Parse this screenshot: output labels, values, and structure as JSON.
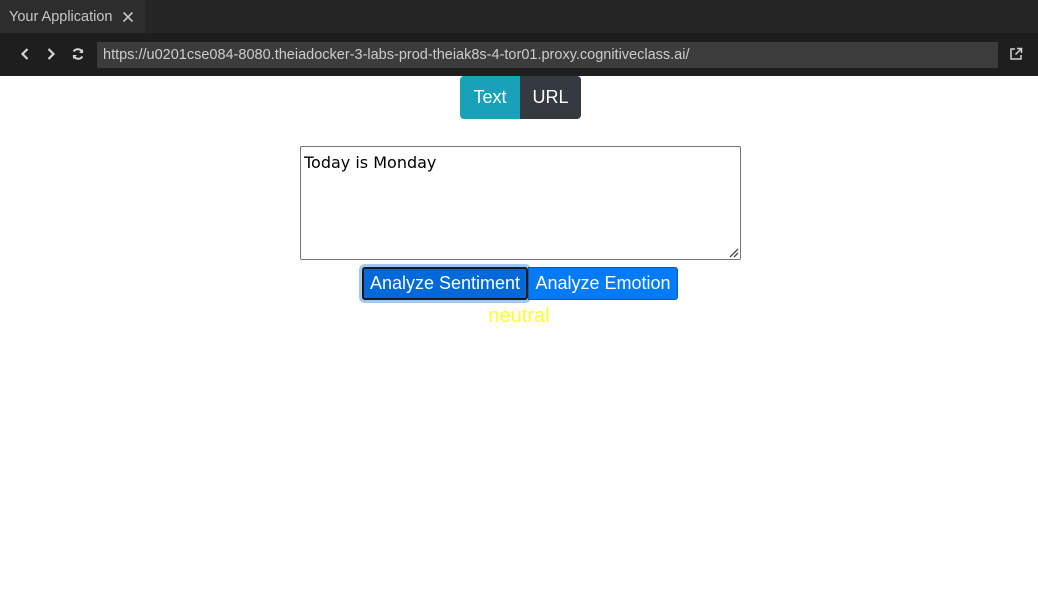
{
  "tab": {
    "title": "Your Application",
    "close_icon": "close-icon"
  },
  "toolbar": {
    "back_icon": "chevron-left-icon",
    "forward_icon": "chevron-right-icon",
    "reload_icon": "refresh-icon",
    "url": "https://u0201cse084-8080.theiadocker-3-labs-prod-theiak8s-4-tor01.proxy.cognitiveclass.ai/",
    "open_external_icon": "external-link-icon"
  },
  "modes": {
    "text_label": "Text",
    "url_label": "URL",
    "text_color": "#17a2b8",
    "url_color": "#343a40"
  },
  "input": {
    "value": "Today is Monday"
  },
  "actions": {
    "sentiment_label": "Analyze Sentiment",
    "emotion_label": "Analyze Emotion"
  },
  "result": {
    "text": "neutral",
    "color": "#ffff33"
  }
}
